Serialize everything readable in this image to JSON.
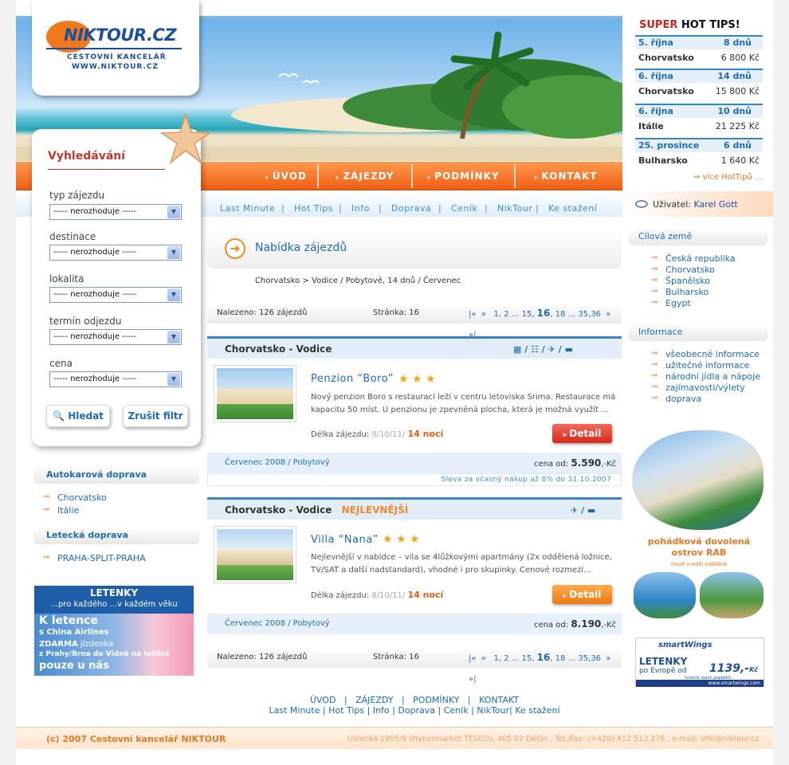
{
  "logo": {
    "name": "NIKTOUR.CZ",
    "line1": "CESTOVNÍ KANCELÁŘ",
    "line2": "WWW.NIKTOUR.CZ"
  },
  "nav": {
    "items": [
      "ÚVOD",
      "ZÁJEZDY",
      "PODMÍNKY",
      "KONTAKT"
    ]
  },
  "subnav": {
    "items": [
      "Last Minute",
      "Hot Tips",
      "Info",
      "Doprava",
      "Ceník",
      "NikTour",
      "Ke stažení"
    ],
    "separator": "|"
  },
  "search": {
    "title": "Vyhledávání",
    "fields": [
      {
        "label": "typ zájezdu",
        "value": "----- nerozhoduje -----"
      },
      {
        "label": "destinace",
        "value": "----- nerozhoduje -----"
      },
      {
        "label": "lokalita",
        "value": "----- nerozhoduje -----"
      },
      {
        "label": "termín odjezdu",
        "value": "----- nerozhoduje -----"
      },
      {
        "label": "cena",
        "value": "----- nerozhoduje -----"
      }
    ],
    "search_button": "Hledat",
    "reset_button": "Zrušit filtr"
  },
  "left": {
    "bus": {
      "title": "Autokarová doprava",
      "links": [
        "Chorvatsko",
        "Itálie"
      ]
    },
    "air": {
      "title": "Letecká doprava",
      "links": [
        "PRAHA-SPLIT-PRAHA"
      ]
    },
    "banner": {
      "title": "LETENKY",
      "subtitle": "...pro každého ...v každém věku",
      "big": "K letence",
      "airline": "s China Airlines",
      "free": "ZDARMA",
      "free_text": "jízdenka",
      "route": "z Prahy/Brna do Vídně na letiště",
      "only": "pouze u nás"
    }
  },
  "hot_tips": {
    "title_a": "SUPER",
    "title_b": "HOT TIPS!",
    "items": [
      {
        "date": "5. října",
        "days": "8 dnů",
        "dest": "Chorvatsko",
        "price": "6 800 Kč"
      },
      {
        "date": "6. října",
        "days": "14 dnů",
        "dest": "Chorvatsko",
        "price": "15 800 Kč"
      },
      {
        "date": "6. října",
        "days": "10 dnů",
        "dest": "Itálie",
        "price": "21 225 Kč"
      },
      {
        "date": "25. prosince",
        "days": "6 dnů",
        "dest": "Bulharsko",
        "price": "1 640 Kč"
      }
    ],
    "more": "více HotTipů ..."
  },
  "user": {
    "label": "Uživatel:",
    "name": "Karel Gott"
  },
  "right": {
    "countries": {
      "title": "Cílová země",
      "links": [
        "Česká republika",
        "Chorvatsko",
        "Španělsko",
        "Bulharsko",
        "Egypt"
      ]
    },
    "info": {
      "title": "Informace",
      "links": [
        "všeobecné informace",
        "užitečné informace",
        "národní jídla a nápoje",
        "zajímavosti/výlety",
        "doprava"
      ]
    },
    "promo": {
      "line1": "pohádková dovolená",
      "line2": "ostrov RAB",
      "line3": "nově v naší nabídce"
    },
    "smartwings": {
      "brand": "smartWings",
      "title": "LETENKY",
      "text": "po Evropě od",
      "price": "1139,-",
      "currency": "Kč",
      "note": "*včetně všech poplatků",
      "url": "www.smartwings.com"
    }
  },
  "main": {
    "title": "Nabídka zájezdů",
    "breadcrumb": "Chorvatsko > Vodice /  Pobytové, 14 dnů / Červenec",
    "found": "Nalezeno: 126 zájezdů",
    "page": "Stránka: 16",
    "pager": {
      "before": "1, 2 ... 15,",
      "current": "16",
      "after": ", 18 ... 35,36"
    },
    "offers": [
      {
        "location": "Chorvatsko - Vodice",
        "tag": "",
        "name": "Penzion “Boro”",
        "stars": 3,
        "desc": "Nový penzion Boro s restaurací leží v centru letoviska Srima. Restaurace má kapacitu 50 míst. U penzionu je zpevněná plocha, která je možná využít ...",
        "length_label": "Délka zájezdu:",
        "dates": "8/10/11/",
        "nights": "14 nocí",
        "detail": "Detail",
        "month": "Červenec 2008 / Pobytový",
        "price_label": "cena od:",
        "price": "5.590",
        "price_suffix": ",-Kč",
        "discount": "Sleva za včasný nákup až 8% do 31.10.2007"
      },
      {
        "location": "Chorvatsko - Vodice",
        "tag": "NEJLEVNĚJŠÍ",
        "name": "Villa “Nana”",
        "stars": 3,
        "desc": "Nejlevnější v nabídce – vila se 4lůžkovými apartmány (2x oddělená ložnice, TV/SAT a další nadstandard), vhodné i pro skupinky. Cenové rozmezí...",
        "length_label": "Délka zájezdu:",
        "dates": "8/10/11/",
        "nights": "14 nocí",
        "detail": "Detail",
        "month": "Červenec 2008 / Pobytový",
        "price_label": "cena od:",
        "price": "8.190",
        "price_suffix": ",-Kč"
      }
    ]
  },
  "footer": {
    "links1": "ÚVOD   |   ZÁJEZDY   |   PODMÍNKY   |   KONTAKT",
    "links2": "Last Minute | Hot Tips | Info | Doprava | Ceník | NikTour| Ke stažení",
    "copyright": "(c) 2007 Cestovní kancelář NIKTOUR",
    "address": "Ústecká 1905/8 (Hypermarket TESCO),  405 02 Děčín , Tel./Fax: (+420) 412 513 376 , e-mail: info@niktour.cz"
  },
  "colors": {
    "accent": "#ee5e14",
    "link": "#1e6bb8",
    "heading_red": "#c0392b"
  }
}
